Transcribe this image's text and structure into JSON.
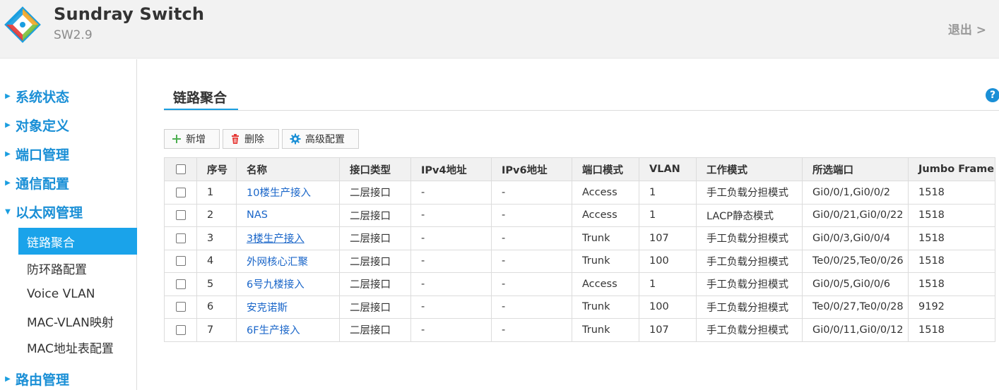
{
  "header": {
    "brand": "Sundray Switch",
    "version": "SW2.9",
    "logout": "退出 >"
  },
  "sidebar": {
    "groups": [
      {
        "label": "系统状态"
      },
      {
        "label": "对象定义"
      },
      {
        "label": "端口管理"
      },
      {
        "label": "通信配置"
      },
      {
        "label": "以太网管理",
        "expanded": true
      },
      {
        "label": "路由管理"
      }
    ],
    "subitems": [
      {
        "label": "链路聚合",
        "active": true
      },
      {
        "label": "防环路配置"
      },
      {
        "label": "Voice VLAN"
      },
      {
        "label": "MAC-VLAN映射"
      },
      {
        "label": "MAC地址表配置"
      }
    ]
  },
  "main": {
    "title": "链路聚合",
    "help": "?",
    "toolbar": {
      "add": "新增",
      "delete": "删除",
      "advanced": "高级配置"
    },
    "columns": [
      "序号",
      "名称",
      "接口类型",
      "IPv4地址",
      "IPv6地址",
      "端口模式",
      "VLAN",
      "工作模式",
      "所选端口",
      "Jumbo Frame"
    ],
    "rows": [
      {
        "no": "1",
        "name": "10楼生产接入",
        "type": "二层接口",
        "ipv4": "-",
        "ipv6": "-",
        "mode": "Access",
        "vlan": "1",
        "work": "手工负载分担模式",
        "ports": "Gi0/0/1,Gi0/0/2",
        "jumbo": "1518"
      },
      {
        "no": "2",
        "name": "NAS",
        "type": "二层接口",
        "ipv4": "-",
        "ipv6": "-",
        "mode": "Access",
        "vlan": "1",
        "work": "LACP静态模式",
        "ports": "Gi0/0/21,Gi0/0/22",
        "jumbo": "1518"
      },
      {
        "no": "3",
        "name": "3楼生产接入",
        "type": "二层接口",
        "ipv4": "-",
        "ipv6": "-",
        "mode": "Trunk",
        "vlan": "107",
        "work": "手工负载分担模式",
        "ports": "Gi0/0/3,Gi0/0/4",
        "jumbo": "1518"
      },
      {
        "no": "4",
        "name": "外网核心汇聚",
        "type": "二层接口",
        "ipv4": "-",
        "ipv6": "-",
        "mode": "Trunk",
        "vlan": "100",
        "work": "手工负载分担模式",
        "ports": "Te0/0/25,Te0/0/26",
        "jumbo": "1518"
      },
      {
        "no": "5",
        "name": "6号九楼接入",
        "type": "二层接口",
        "ipv4": "-",
        "ipv6": "-",
        "mode": "Access",
        "vlan": "1",
        "work": "手工负载分担模式",
        "ports": "Gi0/0/5,Gi0/0/6",
        "jumbo": "1518"
      },
      {
        "no": "6",
        "name": "安克诺斯",
        "type": "二层接口",
        "ipv4": "-",
        "ipv6": "-",
        "mode": "Trunk",
        "vlan": "100",
        "work": "手工负载分担模式",
        "ports": "Te0/0/27,Te0/0/28",
        "jumbo": "9192"
      },
      {
        "no": "7",
        "name": "6F生产接入",
        "type": "二层接口",
        "ipv4": "-",
        "ipv6": "-",
        "mode": "Trunk",
        "vlan": "107",
        "work": "手工负载分担模式",
        "ports": "Gi0/0/11,Gi0/0/12",
        "jumbo": "1518"
      }
    ]
  },
  "colors": {
    "accent": "#1a9ee0",
    "link": "#1a66c9",
    "active_bg": "#1aa3ea",
    "add_icon": "#4caf50",
    "delete_icon": "#e53935",
    "gear_icon": "#1a8fd6"
  }
}
